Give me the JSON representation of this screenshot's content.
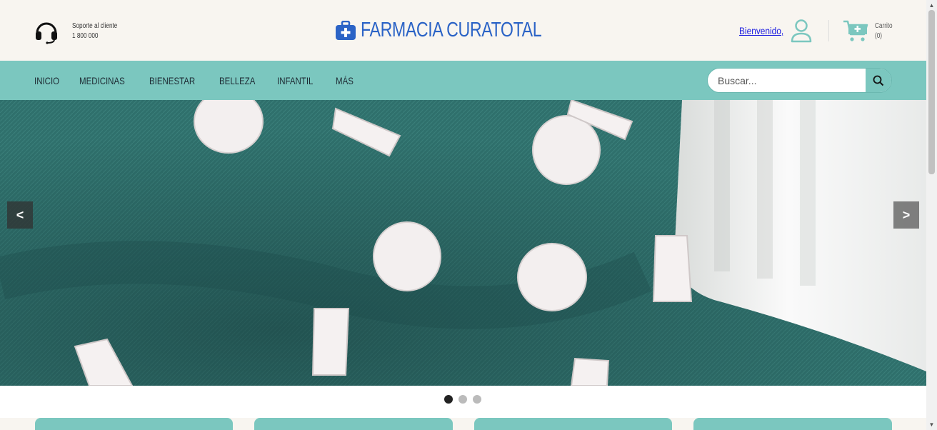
{
  "header": {
    "support_label": "Soporte al cliente",
    "support_phone": "1 800 000",
    "brand_name": "FARMACIA CURATOTAL",
    "welcome": "Bienvenido,",
    "cart_label": "Carrito",
    "cart_count": "(0)"
  },
  "nav": {
    "items": [
      {
        "label": "INICIO"
      },
      {
        "label": "MEDICINAS"
      },
      {
        "label": "BIENESTAR"
      },
      {
        "label": "BELLEZA"
      },
      {
        "label": "INFANTIL"
      },
      {
        "label": "MÁS"
      }
    ],
    "search_placeholder": "Buscar..."
  },
  "carousel": {
    "prev": "<",
    "next": ">",
    "slides": 3,
    "active_slide": 1
  },
  "colors": {
    "accent": "#7bc7bf",
    "brand": "#2b63c6",
    "header_bg": "#f8f5f0"
  }
}
